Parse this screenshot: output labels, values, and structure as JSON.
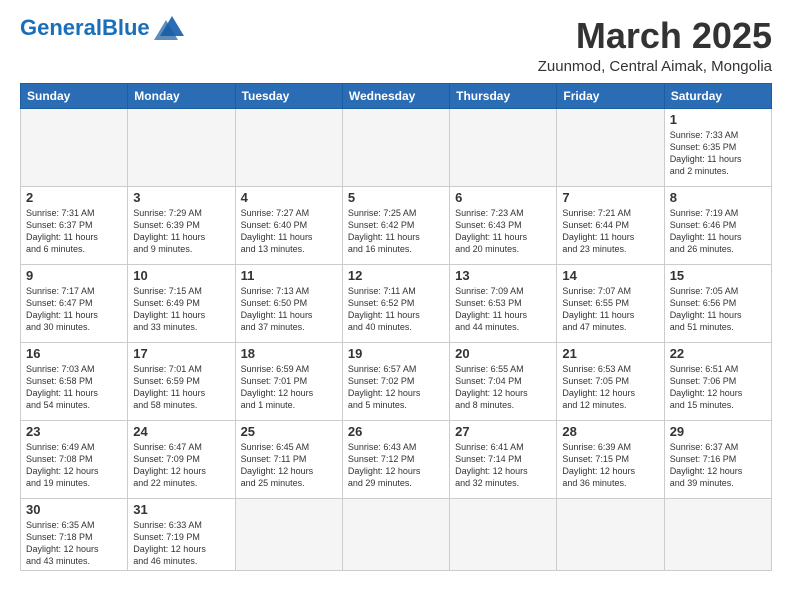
{
  "header": {
    "logo_general": "General",
    "logo_blue": "Blue",
    "month_title": "March 2025",
    "location": "Zuunmod, Central Aimak, Mongolia"
  },
  "weekdays": [
    "Sunday",
    "Monday",
    "Tuesday",
    "Wednesday",
    "Thursday",
    "Friday",
    "Saturday"
  ],
  "weeks": [
    [
      {
        "day": "",
        "info": ""
      },
      {
        "day": "",
        "info": ""
      },
      {
        "day": "",
        "info": ""
      },
      {
        "day": "",
        "info": ""
      },
      {
        "day": "",
        "info": ""
      },
      {
        "day": "",
        "info": ""
      },
      {
        "day": "1",
        "info": "Sunrise: 7:33 AM\nSunset: 6:35 PM\nDaylight: 11 hours\nand 2 minutes."
      }
    ],
    [
      {
        "day": "2",
        "info": "Sunrise: 7:31 AM\nSunset: 6:37 PM\nDaylight: 11 hours\nand 6 minutes."
      },
      {
        "day": "3",
        "info": "Sunrise: 7:29 AM\nSunset: 6:39 PM\nDaylight: 11 hours\nand 9 minutes."
      },
      {
        "day": "4",
        "info": "Sunrise: 7:27 AM\nSunset: 6:40 PM\nDaylight: 11 hours\nand 13 minutes."
      },
      {
        "day": "5",
        "info": "Sunrise: 7:25 AM\nSunset: 6:42 PM\nDaylight: 11 hours\nand 16 minutes."
      },
      {
        "day": "6",
        "info": "Sunrise: 7:23 AM\nSunset: 6:43 PM\nDaylight: 11 hours\nand 20 minutes."
      },
      {
        "day": "7",
        "info": "Sunrise: 7:21 AM\nSunset: 6:44 PM\nDaylight: 11 hours\nand 23 minutes."
      },
      {
        "day": "8",
        "info": "Sunrise: 7:19 AM\nSunset: 6:46 PM\nDaylight: 11 hours\nand 26 minutes."
      }
    ],
    [
      {
        "day": "9",
        "info": "Sunrise: 7:17 AM\nSunset: 6:47 PM\nDaylight: 11 hours\nand 30 minutes."
      },
      {
        "day": "10",
        "info": "Sunrise: 7:15 AM\nSunset: 6:49 PM\nDaylight: 11 hours\nand 33 minutes."
      },
      {
        "day": "11",
        "info": "Sunrise: 7:13 AM\nSunset: 6:50 PM\nDaylight: 11 hours\nand 37 minutes."
      },
      {
        "day": "12",
        "info": "Sunrise: 7:11 AM\nSunset: 6:52 PM\nDaylight: 11 hours\nand 40 minutes."
      },
      {
        "day": "13",
        "info": "Sunrise: 7:09 AM\nSunset: 6:53 PM\nDaylight: 11 hours\nand 44 minutes."
      },
      {
        "day": "14",
        "info": "Sunrise: 7:07 AM\nSunset: 6:55 PM\nDaylight: 11 hours\nand 47 minutes."
      },
      {
        "day": "15",
        "info": "Sunrise: 7:05 AM\nSunset: 6:56 PM\nDaylight: 11 hours\nand 51 minutes."
      }
    ],
    [
      {
        "day": "16",
        "info": "Sunrise: 7:03 AM\nSunset: 6:58 PM\nDaylight: 11 hours\nand 54 minutes."
      },
      {
        "day": "17",
        "info": "Sunrise: 7:01 AM\nSunset: 6:59 PM\nDaylight: 11 hours\nand 58 minutes."
      },
      {
        "day": "18",
        "info": "Sunrise: 6:59 AM\nSunset: 7:01 PM\nDaylight: 12 hours\nand 1 minute."
      },
      {
        "day": "19",
        "info": "Sunrise: 6:57 AM\nSunset: 7:02 PM\nDaylight: 12 hours\nand 5 minutes."
      },
      {
        "day": "20",
        "info": "Sunrise: 6:55 AM\nSunset: 7:04 PM\nDaylight: 12 hours\nand 8 minutes."
      },
      {
        "day": "21",
        "info": "Sunrise: 6:53 AM\nSunset: 7:05 PM\nDaylight: 12 hours\nand 12 minutes."
      },
      {
        "day": "22",
        "info": "Sunrise: 6:51 AM\nSunset: 7:06 PM\nDaylight: 12 hours\nand 15 minutes."
      }
    ],
    [
      {
        "day": "23",
        "info": "Sunrise: 6:49 AM\nSunset: 7:08 PM\nDaylight: 12 hours\nand 19 minutes."
      },
      {
        "day": "24",
        "info": "Sunrise: 6:47 AM\nSunset: 7:09 PM\nDaylight: 12 hours\nand 22 minutes."
      },
      {
        "day": "25",
        "info": "Sunrise: 6:45 AM\nSunset: 7:11 PM\nDaylight: 12 hours\nand 25 minutes."
      },
      {
        "day": "26",
        "info": "Sunrise: 6:43 AM\nSunset: 7:12 PM\nDaylight: 12 hours\nand 29 minutes."
      },
      {
        "day": "27",
        "info": "Sunrise: 6:41 AM\nSunset: 7:14 PM\nDaylight: 12 hours\nand 32 minutes."
      },
      {
        "day": "28",
        "info": "Sunrise: 6:39 AM\nSunset: 7:15 PM\nDaylight: 12 hours\nand 36 minutes."
      },
      {
        "day": "29",
        "info": "Sunrise: 6:37 AM\nSunset: 7:16 PM\nDaylight: 12 hours\nand 39 minutes."
      }
    ],
    [
      {
        "day": "30",
        "info": "Sunrise: 6:35 AM\nSunset: 7:18 PM\nDaylight: 12 hours\nand 43 minutes."
      },
      {
        "day": "31",
        "info": "Sunrise: 6:33 AM\nSunset: 7:19 PM\nDaylight: 12 hours\nand 46 minutes."
      },
      {
        "day": "",
        "info": ""
      },
      {
        "day": "",
        "info": ""
      },
      {
        "day": "",
        "info": ""
      },
      {
        "day": "",
        "info": ""
      },
      {
        "day": "",
        "info": ""
      }
    ]
  ]
}
